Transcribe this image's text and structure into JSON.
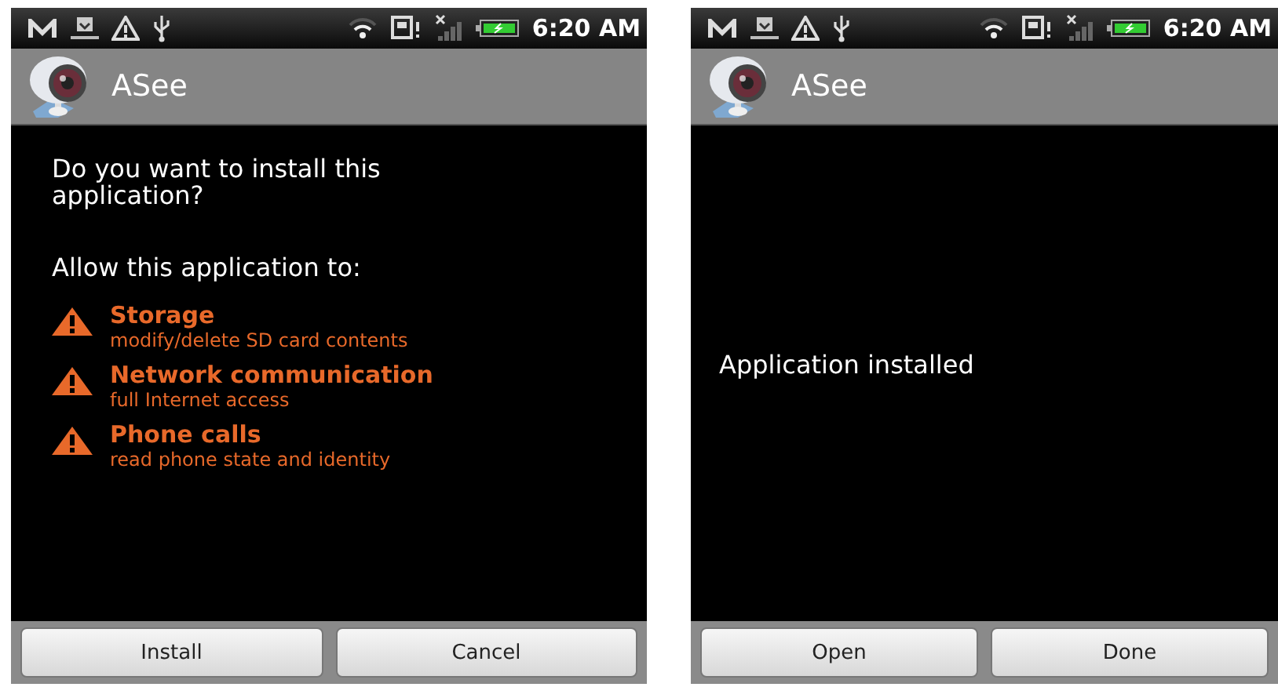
{
  "screens": [
    {
      "kind": "permissions",
      "status_bar": {
        "time": "6:20 AM"
      },
      "title": "ASee",
      "question": "Do you want to install this application?",
      "allow_heading": "Allow this application to:",
      "permissions": [
        {
          "name": "Storage",
          "description": "modify/delete SD card contents"
        },
        {
          "name": "Network communication",
          "description": "full Internet access"
        },
        {
          "name": "Phone calls",
          "description": "read phone state and identity"
        }
      ],
      "buttons": [
        "Install",
        "Cancel"
      ]
    },
    {
      "kind": "result",
      "status_bar": {
        "time": "6:20 AM"
      },
      "title": "ASee",
      "message": "Application installed",
      "buttons": [
        "Open",
        "Done"
      ]
    }
  ]
}
